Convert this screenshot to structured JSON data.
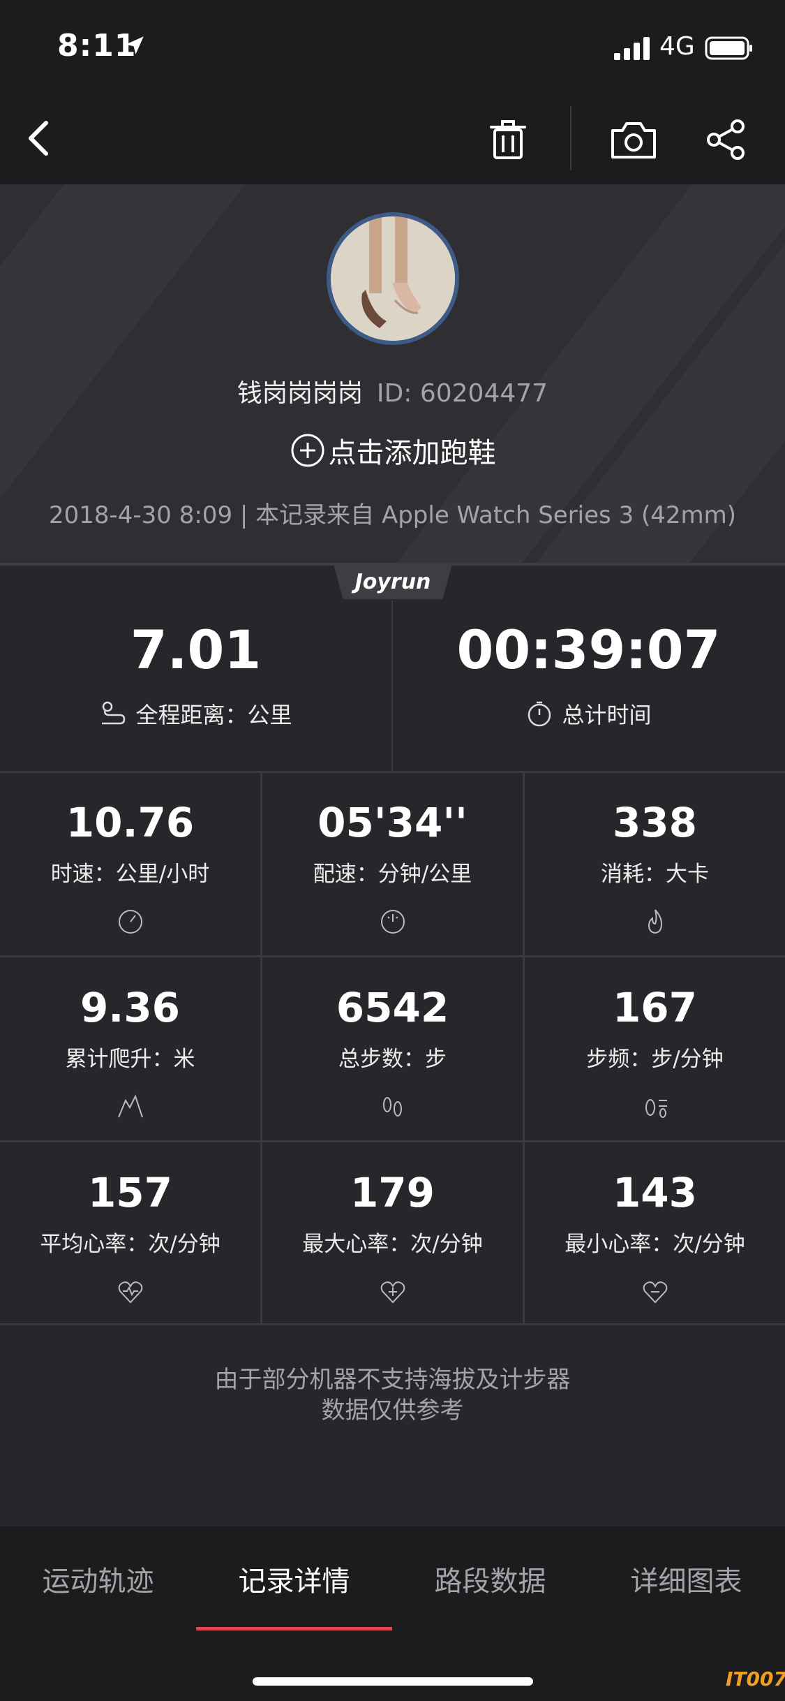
{
  "status_bar": {
    "time": "8:11",
    "network": "4G"
  },
  "header": {
    "icons": [
      "back-icon",
      "trash-icon",
      "camera-icon",
      "share-icon"
    ]
  },
  "profile": {
    "name": "钱岗岗岗岗",
    "user_id": "ID: 60204477",
    "add_shoe": "点击添加跑鞋",
    "record_info": "2018-4-30 8:09 | 本记录来自 Apple Watch Series 3 (42mm)"
  },
  "brand_tab": "Joyrun",
  "main_stats": [
    {
      "value": "7.01",
      "label": "全程距离：公里",
      "icon": "route-icon"
    },
    {
      "value": "00:39:07",
      "label": "总计时间",
      "icon": "stopwatch-icon"
    }
  ],
  "stats": [
    {
      "value": "10.76",
      "label": "时速：公里/小时",
      "icon": "speedometer-icon"
    },
    {
      "value": "05'34''",
      "label": "配速：分钟/公里",
      "icon": "pace-dial-icon"
    },
    {
      "value": "338",
      "label": "消耗：大卡",
      "icon": "flame-icon"
    },
    {
      "value": "9.36",
      "label": "累计爬升：米",
      "icon": "mountain-icon"
    },
    {
      "value": "6542",
      "label": "总步数：步",
      "icon": "footprints-icon"
    },
    {
      "value": "167",
      "label": "步频：步/分钟",
      "icon": "cadence-icon"
    },
    {
      "value": "157",
      "label": "平均心率：次/分钟",
      "icon": "heart-wave-icon"
    },
    {
      "value": "179",
      "label": "最大心率：次/分钟",
      "icon": "heart-plus-icon"
    },
    {
      "value": "143",
      "label": "最小心率：次/分钟",
      "icon": "heart-minus-icon"
    }
  ],
  "disclaimer": {
    "line1": "由于部分机器不支持海拔及计步器",
    "line2": "数据仅供参考"
  },
  "tabs": [
    {
      "label": "运动轨迹"
    },
    {
      "label": "记录详情"
    },
    {
      "label": "路段数据"
    },
    {
      "label": "详细图表"
    }
  ],
  "watermark": "IT007",
  "colors": {
    "accent": "#e0474c",
    "avatar_ring": "#3e5a86"
  }
}
